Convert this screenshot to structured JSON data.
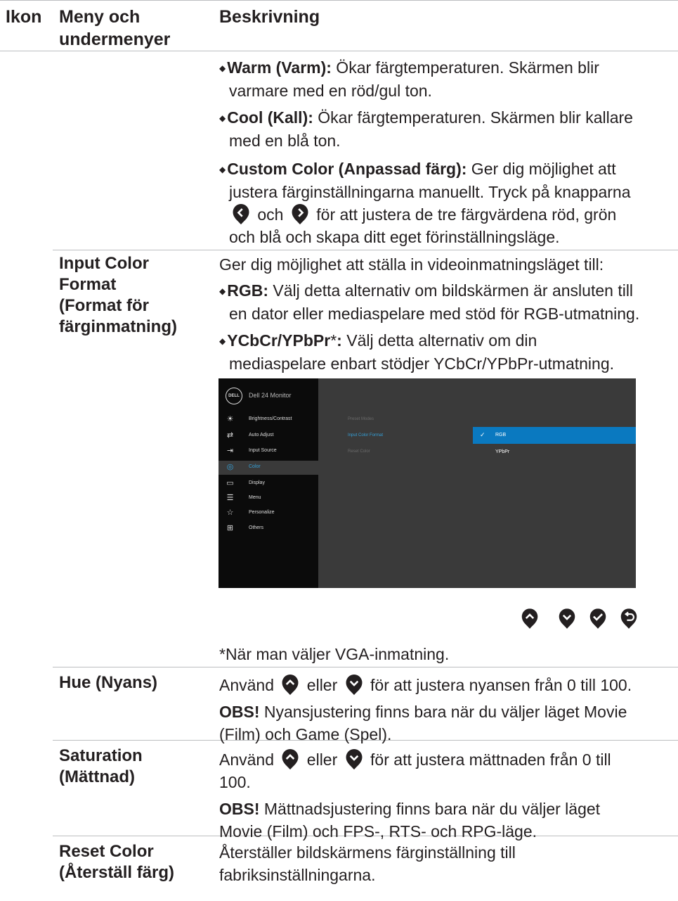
{
  "header": {
    "col_icon": "Ikon",
    "col_menu": "Meny och undermenyer",
    "col_desc": "Beskrivning"
  },
  "preset_bullets": {
    "warm_term": "Warm (Varm):",
    "warm_text": " Ökar färgtemperaturen. Skärmen blir",
    "warm_text2": "varmare med en röd/gul ton.",
    "cool_term": "Cool (Kall):",
    "cool_text": " Ökar färgtemperaturen. Skärmen blir kallare",
    "cool_text2": "med en blå ton.",
    "custom_term": "Custom Color (Anpassad färg):",
    "custom_text": " Ger dig möjlighet att",
    "custom_text2": "justera färginställningarna manuellt. Tryck på knapparna",
    "custom_och": " och ",
    "custom_text3": " för att justera de tre färgvärdena röd, grön",
    "custom_text4": "och blå och skapa ditt eget förinställningsläge."
  },
  "input_color": {
    "menu_line1": "Input Color",
    "menu_line2": "Format",
    "menu_line3": "(Format för",
    "menu_line4": "färginmatning)",
    "intro": "Ger dig möjlighet att ställa in videoinmatningsläget till:",
    "rgb_term": "RGB:",
    "rgb_text": " Välj detta alternativ om bildskärmen är ansluten till",
    "rgb_text2": "en dator eller mediaspelare med stöd för RGB-utmatning.",
    "ycbcr_term": "YCbCr/YPbPr",
    "ycbcr_star": "*",
    "ycbcr_colon": ":",
    "ycbcr_text": " Välj detta alternativ om din",
    "ycbcr_text2": "mediaspelare enbart stödjer YCbCr/YPbPr-utmatning.",
    "footnote": "*När man väljer VGA-inmatning."
  },
  "osd": {
    "logo": "DELL",
    "model": "Dell 24 Monitor",
    "menu": [
      "Brightness/Contrast",
      "Auto Adjust",
      "Input Source",
      "Color",
      "Display",
      "Menu",
      "Personalize",
      "Others"
    ],
    "submenu": [
      "Preset Modes",
      "Input Color Format",
      "Reset Color"
    ],
    "options": [
      "RGB",
      "YPbPr"
    ]
  },
  "hue": {
    "menu": "Hue (Nyans)",
    "t1": "Använd ",
    "t2": " eller ",
    "t3": " för att justera nyansen från 0 till 100.",
    "obs": "OBS!",
    "note": " Nyansjustering finns bara när du väljer läget Movie",
    "note2": "(Film) och Game (Spel)."
  },
  "saturation": {
    "menu_line1": "Saturation",
    "menu_line2": "(Mättnad)",
    "t1": "Använd ",
    "t2": " eller ",
    "t3": " för att justera mättnaden från 0 till",
    "t4": "100.",
    "obs": "OBS!",
    "note": " Mättnadsjustering finns bara när du väljer läget",
    "note2": "Movie (Film) och FPS-, RTS- och RPG-läge."
  },
  "reset": {
    "menu_line1": "Reset Color",
    "menu_line2": "(Återställ färg)",
    "text": "Återställer bildskärmens färginställning till",
    "text2": "fabriksinställningarna."
  }
}
